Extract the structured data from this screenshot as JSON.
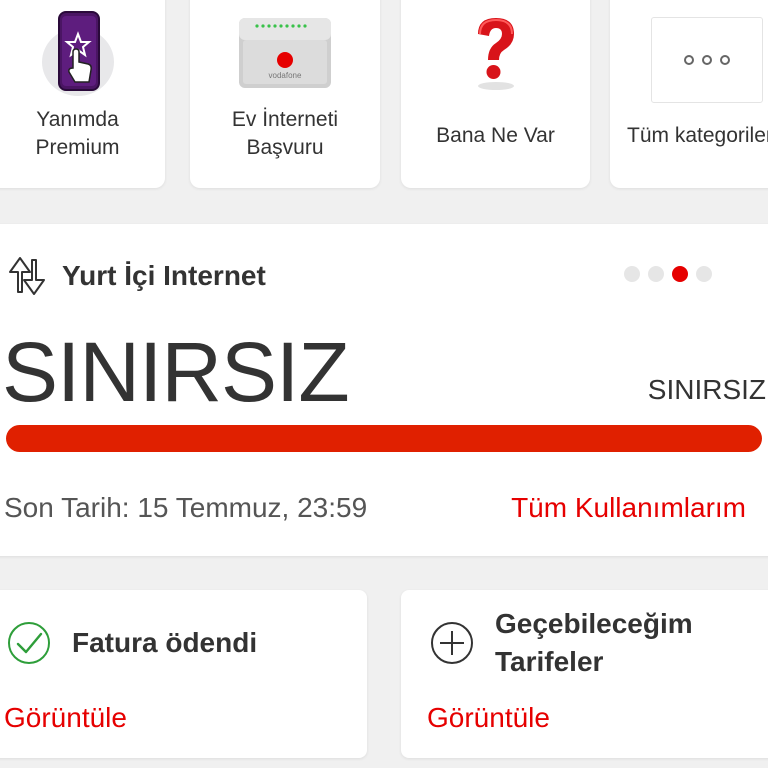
{
  "categories": [
    {
      "label_line1": "Yanımda",
      "label_line2": "Premium",
      "icon": "premium-phone-icon"
    },
    {
      "label_line1": "Ev İnterneti",
      "label_line2": "Başvuru",
      "icon": "modem-icon"
    },
    {
      "label_line1": "Bana Ne Var",
      "label_line2": "",
      "icon": "question-mark-icon"
    },
    {
      "label_line1": "Tüm kategoriler",
      "label_line2": "",
      "icon": "more-icon"
    }
  ],
  "modem_brand": "vodafone",
  "usage": {
    "title": "Yurt İçi Internet",
    "big_value": "SINIRSIZ",
    "side_value": "SINIRSIZ",
    "progress_fraction": 1.0,
    "deadline": "Son Tarih: 15 Temmuz, 23:59",
    "all_usage_link": "Tüm Kullanımlarım",
    "pager_count": 4,
    "pager_active_index": 2
  },
  "bill": {
    "title": "Fatura ödendi",
    "link": "Görüntüle"
  },
  "tariffs": {
    "title_line1": "Geçebileceğim",
    "title_line2": "Tarifeler",
    "link": "Görüntüle"
  },
  "colors": {
    "accent": "#e60000",
    "bar": "#e02000",
    "check": "#2e9e3a"
  }
}
